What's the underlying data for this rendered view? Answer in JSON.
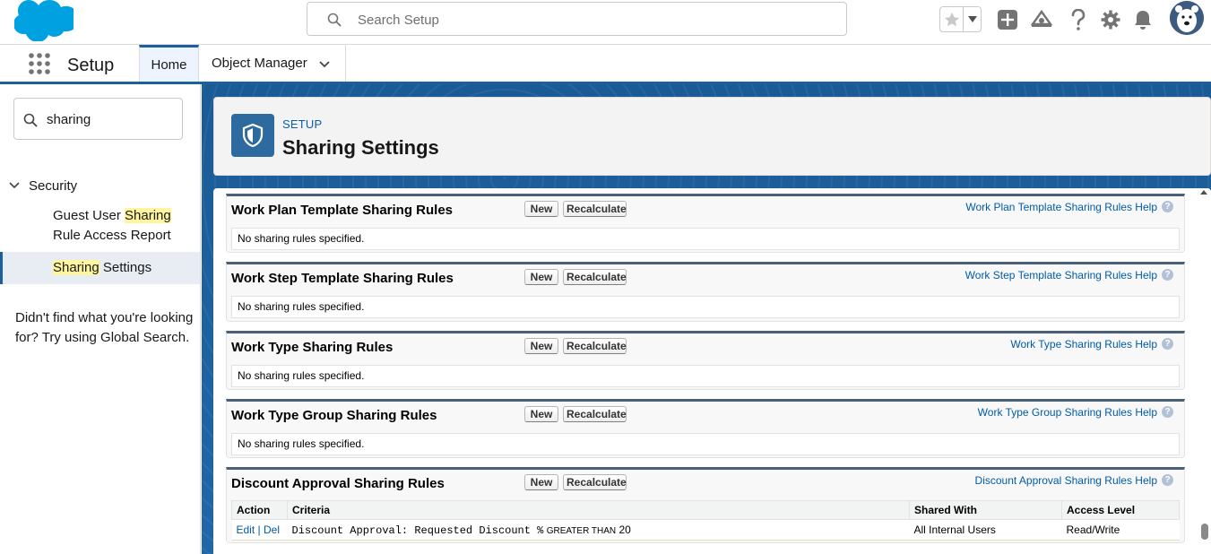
{
  "header": {
    "search_placeholder": "Search Setup"
  },
  "app_nav": {
    "app_name": "Setup",
    "tabs": [
      {
        "label": "Home"
      },
      {
        "label": "Object Manager"
      }
    ]
  },
  "sidebar": {
    "quick_find_value": "sharing",
    "tree": {
      "root_label": "Security",
      "items": [
        {
          "prefix": "Guest User ",
          "highlight": "Sharing",
          "suffix": " Rule Access Report"
        },
        {
          "prefix": "",
          "highlight": "Sharing",
          "suffix": " Settings"
        }
      ]
    },
    "not_found_text": "Didn't find what you're looking for? Try using Global Search."
  },
  "page_header": {
    "eyebrow": "SETUP",
    "title": "Sharing Settings"
  },
  "buttons": {
    "new": "New",
    "recalculate": "Recalculate"
  },
  "sections": [
    {
      "title": "Work Plan Template Sharing Rules",
      "help": "Work Plan Template Sharing Rules Help",
      "body": "No sharing rules specified."
    },
    {
      "title": "Work Step Template Sharing Rules",
      "help": "Work Step Template Sharing Rules Help",
      "body": "No sharing rules specified."
    },
    {
      "title": "Work Type Sharing Rules",
      "help": "Work Type Sharing Rules Help",
      "body": "No sharing rules specified."
    },
    {
      "title": "Work Type Group Sharing Rules",
      "help": "Work Type Group Sharing Rules Help",
      "body": "No sharing rules specified."
    },
    {
      "title": "Discount Approval Sharing Rules",
      "help": "Discount Approval Sharing Rules Help"
    }
  ],
  "discount_table": {
    "headers": [
      "Action",
      "Criteria",
      "Shared With",
      "Access Level"
    ],
    "row": {
      "edit": "Edit",
      "separator": "|",
      "del": "Del",
      "criteria_field": "Discount Approval: Requested Discount %",
      "operator": "GREATER THAN",
      "value": "20",
      "shared_with": "All Internal Users",
      "access_level": "Read/Write"
    }
  },
  "help_glyph": "?",
  "colors": {
    "brand_blue": "#1b5f9e",
    "link_blue": "#015ba7",
    "highlight": "#fff59d"
  }
}
